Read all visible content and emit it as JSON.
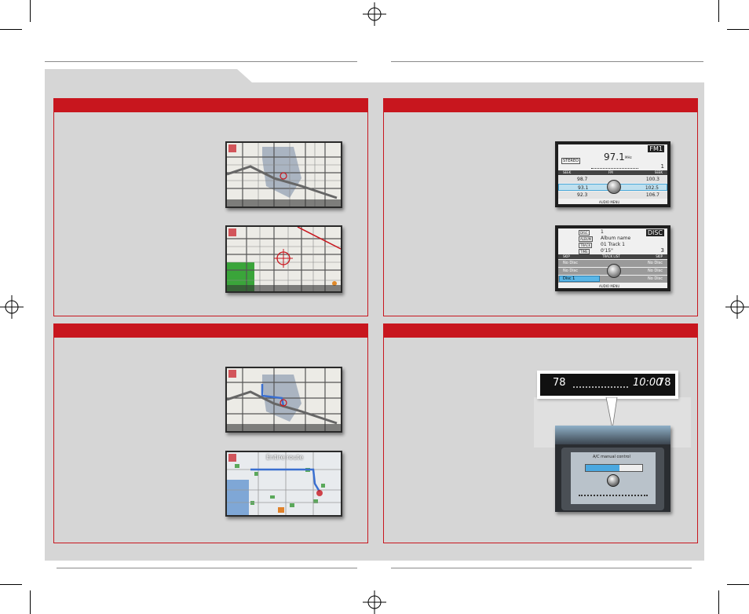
{
  "audio_fm": {
    "band": "FM1",
    "frequency": "97.1",
    "unit": "MHz",
    "stereo": "STEREO",
    "preset_number": "1",
    "seek_label": "SEEK",
    "seek_right": "SEEK",
    "fm_label": "FM",
    "audio_menu": "AUDIO MENU",
    "presets_left": [
      "98.7",
      "93.1",
      "92.3"
    ],
    "presets_right": [
      "100.3",
      "102.5",
      "106.7"
    ]
  },
  "audio_disc": {
    "mode": "DISC",
    "disc_label": "DISC",
    "album_label": "ALBUM",
    "track_label": "TRACK",
    "time_label": "TIME",
    "disc_value": "1",
    "album_value": "Album name",
    "track_value": "01 Track 1",
    "time_value": "0'15\"",
    "disc_number": "3",
    "skip_left": "SKIP",
    "track_list": "TRACK LIST",
    "skip_right": "SKIP",
    "audio_menu": "AUDIO MENU",
    "slots_left": [
      "No Disc",
      "No Disc",
      "Disc 1"
    ],
    "slots_right": [
      "No Disc",
      "No Disc",
      "No Disc"
    ]
  },
  "nav_route": {
    "banner": "Entire route"
  },
  "climate": {
    "temp_left": "78",
    "temp_right": "78",
    "clock": "10:00",
    "screen_title": "A/C manual control"
  },
  "colors": {
    "accent_red": "#c8161e",
    "sheet_gray": "#d6d6d6"
  }
}
